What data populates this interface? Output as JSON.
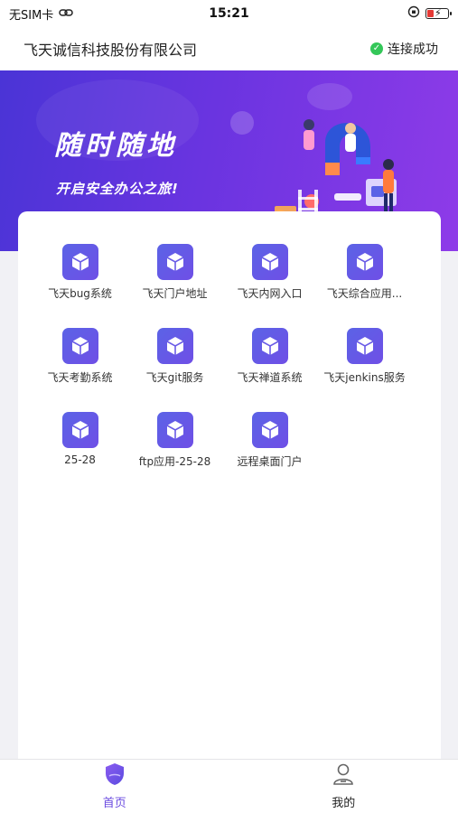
{
  "status_bar": {
    "carrier": "无SIM卡",
    "time": "15:21",
    "battery_color": "#e53935"
  },
  "header": {
    "company": "飞天诚信科技股份有限公司",
    "connection_status": "连接成功",
    "status_color": "#34c759"
  },
  "banner": {
    "title": "随时随地",
    "subtitle": "开启安全办公之旅!"
  },
  "apps": [
    {
      "label": "飞天bug系统",
      "icon": "cube-icon"
    },
    {
      "label": "飞天门户地址",
      "icon": "cube-icon"
    },
    {
      "label": "飞天内网入口",
      "icon": "cube-icon"
    },
    {
      "label": "飞天综合应用...",
      "icon": "cube-icon"
    },
    {
      "label": "飞天考勤系统",
      "icon": "cube-icon"
    },
    {
      "label": "飞天git服务",
      "icon": "cube-icon"
    },
    {
      "label": "飞天禅道系统",
      "icon": "cube-icon"
    },
    {
      "label": "飞天jenkins服务",
      "icon": "cube-icon"
    },
    {
      "label": "25-28",
      "icon": "cube-icon"
    },
    {
      "label": "ftp应用-25-28",
      "icon": "cube-icon"
    },
    {
      "label": "远程桌面门户",
      "icon": "cube-icon"
    }
  ],
  "tabbar": {
    "home_label": "首页",
    "mine_label": "我的",
    "active_color": "#6b4be0"
  }
}
